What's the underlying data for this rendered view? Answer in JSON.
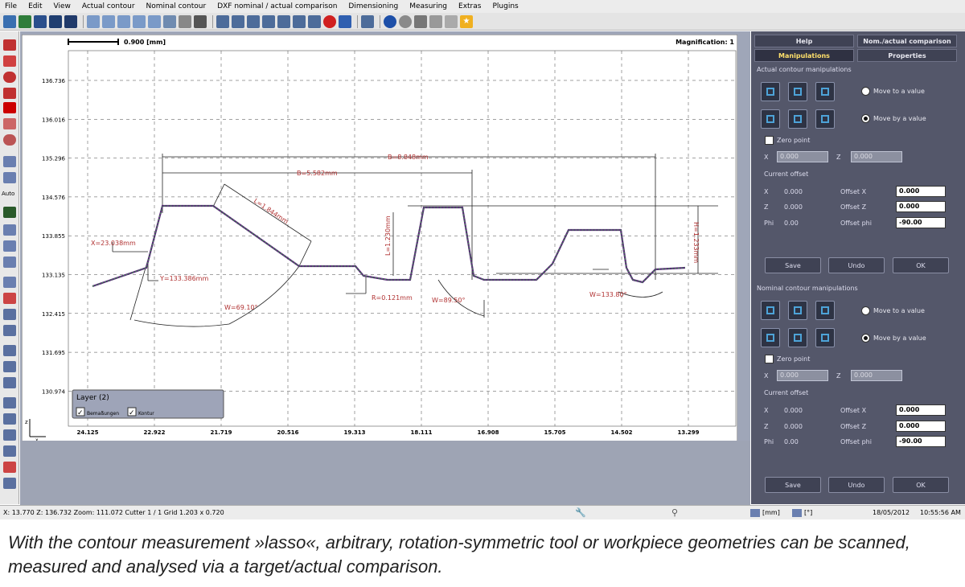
{
  "menu": [
    "File",
    "Edit",
    "View",
    "Actual contour",
    "Nominal contour",
    "DXF nominal / actual comparison",
    "Dimensioning",
    "Measuring",
    "Extras",
    "Plugins"
  ],
  "toolbar_icons": [
    "new-doc-icon",
    "open-icon",
    "save-icon",
    "save-as-icon",
    "print-icon",
    "zoom-in-icon",
    "zoom-out-icon",
    "zoom-window-icon",
    "zoom-fit-icon",
    "zoom-prev-icon",
    "grid-icon",
    "probe-icon",
    "measure-icon",
    "cursor-icon",
    "dimension-icon",
    "delete-icon",
    "undo-icon",
    "info-icon",
    "settings-icon",
    "edit-icon",
    "star-icon"
  ],
  "canvas": {
    "scale_label": "0.900 [mm]",
    "magnification": "Magnification: 1",
    "y_ticks": [
      "136.736",
      "136.016",
      "135.296",
      "134.576",
      "133.855",
      "133.135",
      "132.415",
      "131.695",
      "130.974"
    ],
    "x_ticks": [
      "24.125",
      "22.922",
      "21.719",
      "20.516",
      "19.313",
      "18.111",
      "16.908",
      "15.705",
      "14.502",
      "13.299"
    ],
    "dims": {
      "b1": "B=8.848mm",
      "b2": "B=5.582mm",
      "l1": "L=1.844mm",
      "x1": "X=23.038mm",
      "y1": "Y=133.386mm",
      "w1": "W=69.10°",
      "r1": "R=0.121mm",
      "l2": "L=1.230mm",
      "w2": "W=89.50°",
      "w3": "W=133.80°",
      "h1": "H=1.233mm"
    },
    "layer_title": "Layer (2)",
    "layer_items": [
      "Bemaßungen",
      "Kontur"
    ],
    "axis_z": "z",
    "axis_x": "x"
  },
  "panel": {
    "tabs": [
      "Help",
      "Nom./actual comparison",
      "Manipulations",
      "Properties"
    ],
    "actual_title": "Actual contour manipulations",
    "nominal_title": "Nominal contour manipulations",
    "move_to": "Move to a value",
    "move_by": "Move by a value",
    "zero_point": "Zero point",
    "x_label": "X",
    "z_label": "Z",
    "zp_x": "0.000",
    "zp_z": "0.000",
    "current_offset": "Current offset",
    "phi_label": "Phi",
    "offset_x_label": "Offset X",
    "offset_z_label": "Offset Z",
    "offset_phi_label": "Offset phi",
    "actual": {
      "x": "0.000",
      "z": "0.000",
      "phi": "0.00",
      "offset_x": "0.000",
      "offset_z": "0.000",
      "offset_phi": "-90.00"
    },
    "nominal": {
      "x": "0.000",
      "z": "0.000",
      "phi": "0.00",
      "offset_x": "0.000",
      "offset_z": "0.000",
      "offset_phi": "-90.00"
    },
    "save": "Save",
    "undo": "Undo",
    "ok": "OK"
  },
  "status": {
    "coords": "X: 13.770  Z: 136.732  Zoom: 111.072  Cutter 1 / 1  Grid 1.203 x 0.720",
    "unit": "[mm]",
    "angle_unit": "[°]",
    "date": "18/05/2012",
    "time": "10:55:56 AM"
  },
  "caption": "With the contour measurement »lasso«, arbitrary, rotation-symmetric tool or workpiece geometries can be scanned, measured and analysed via a target/actual comparison.",
  "colors": {
    "panel_bg": "#54576a",
    "dim_red": "#b03030",
    "contour_green": "#3c9a48",
    "contour_purple": "#5a2a7a"
  }
}
